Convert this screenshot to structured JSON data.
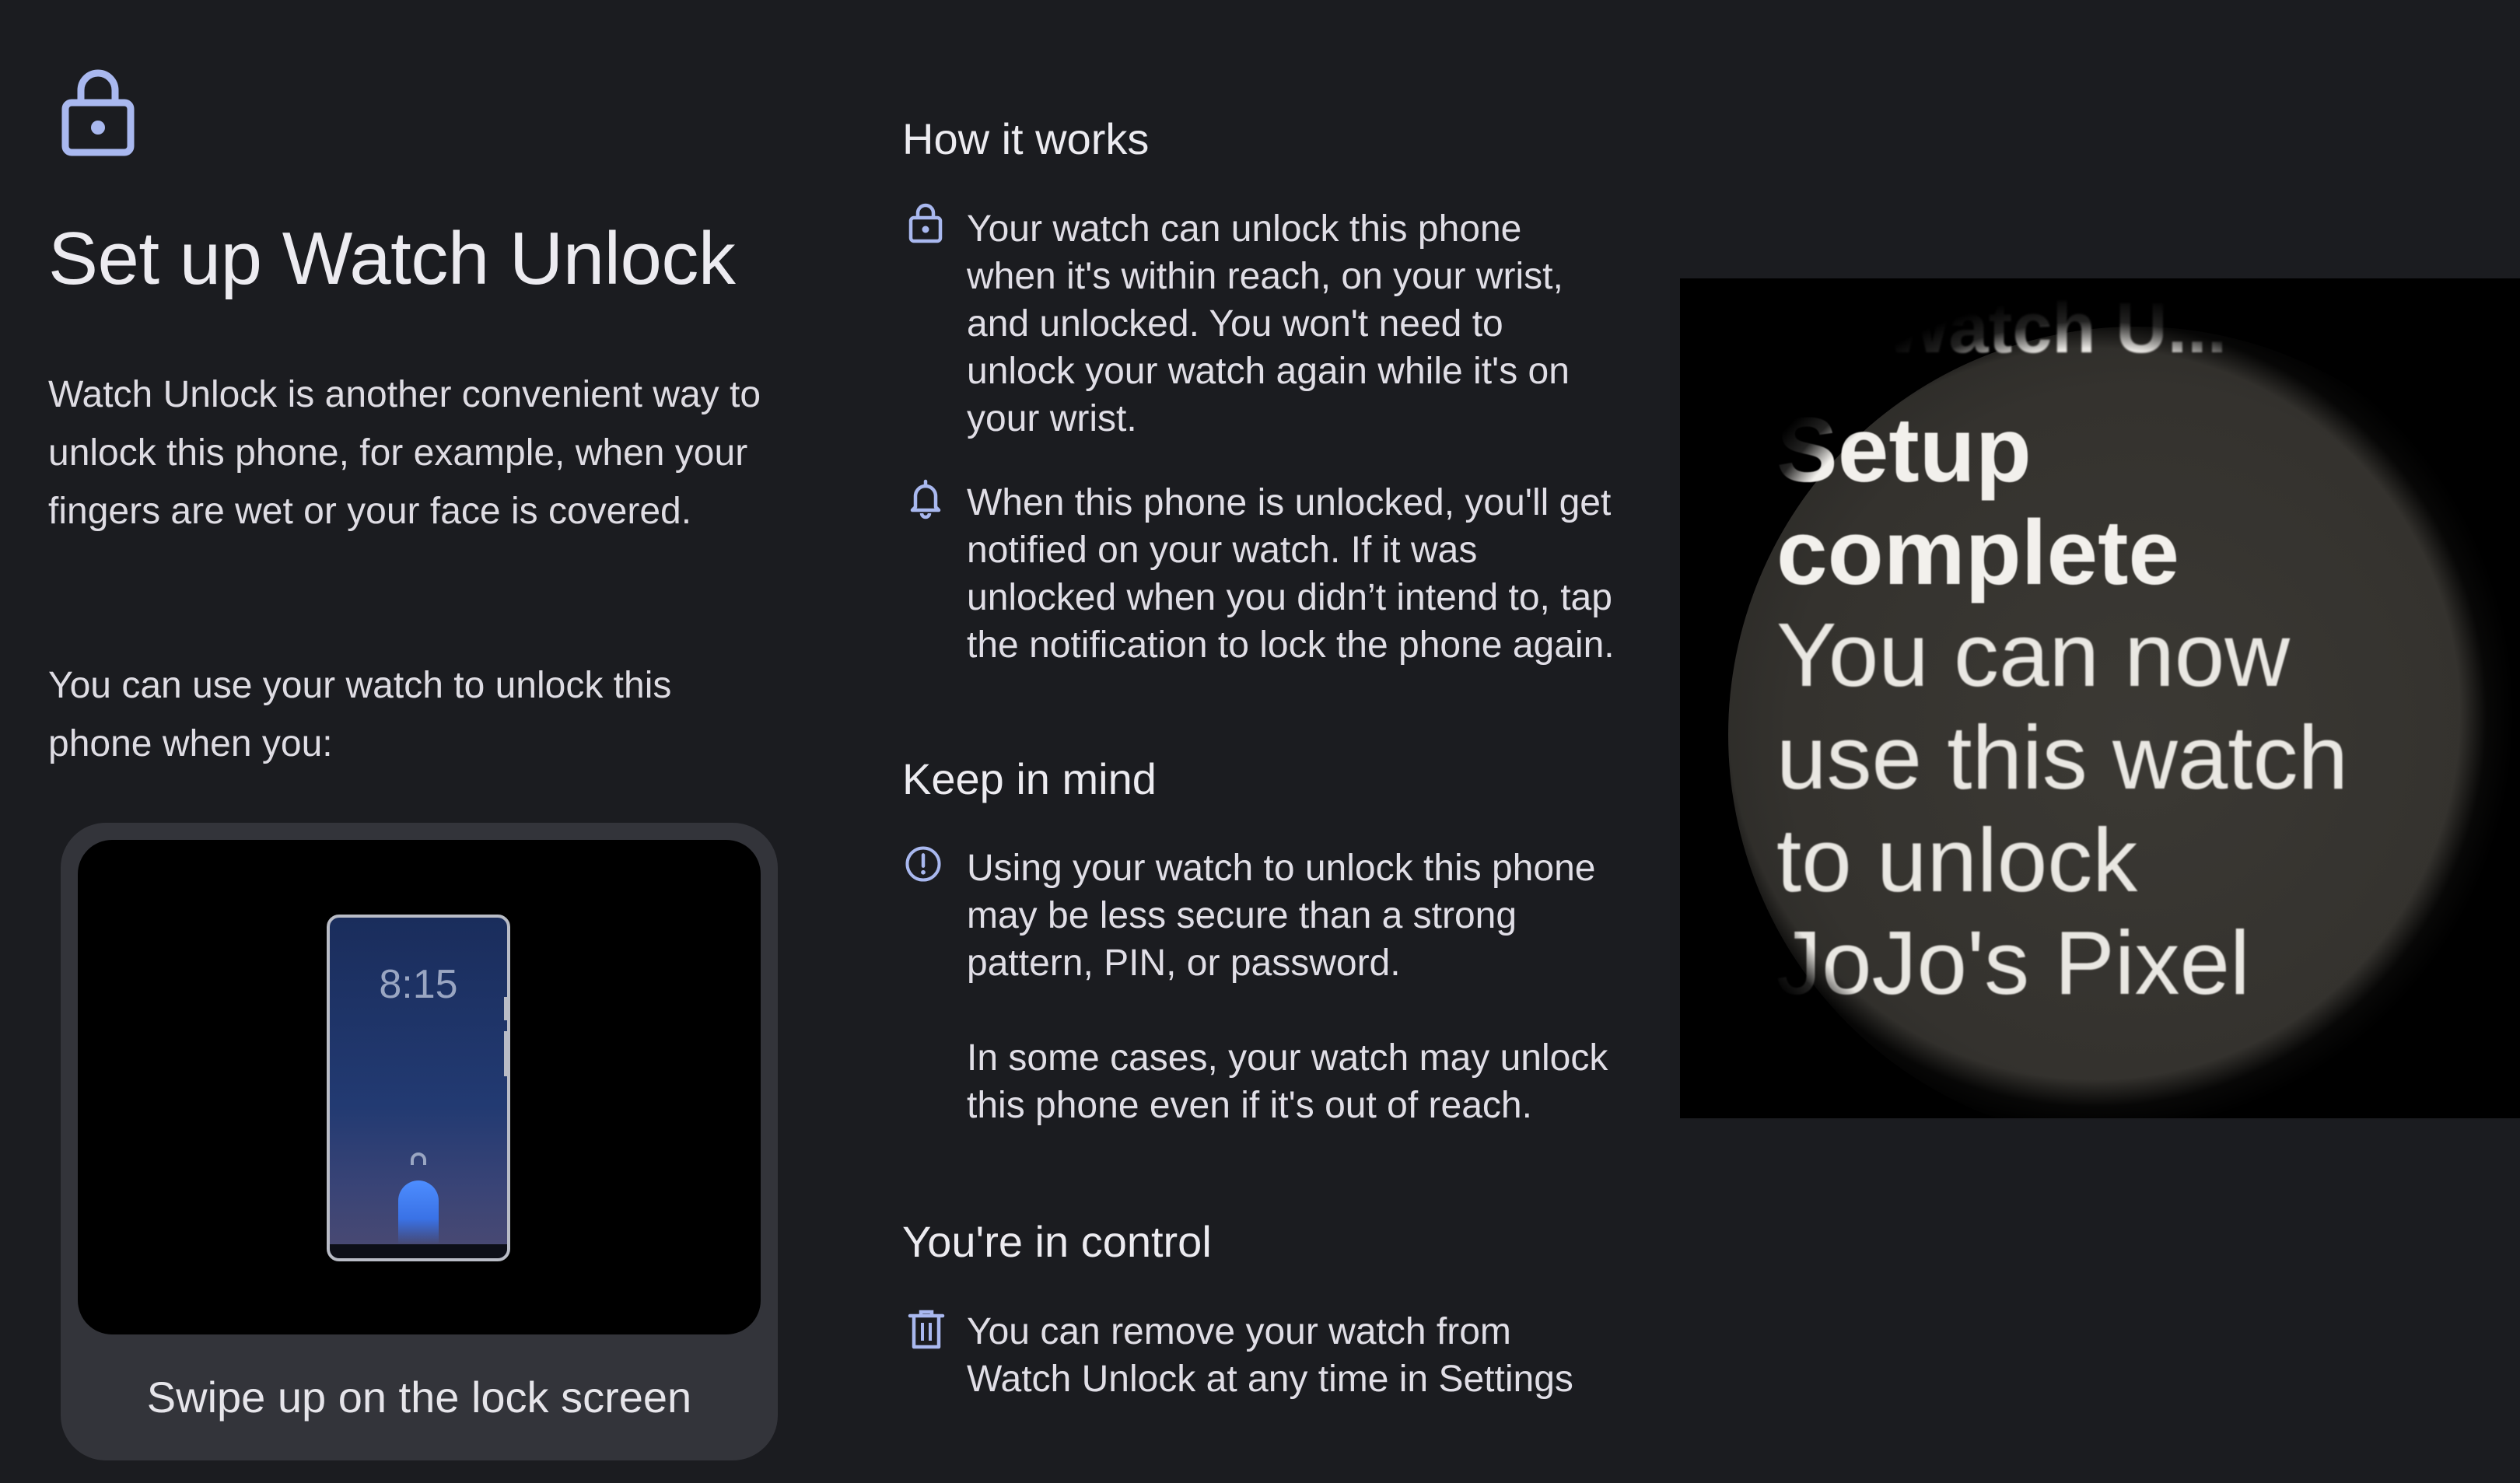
{
  "colors": {
    "background": "#1b1c20",
    "icon_accent": "#a9b8ef",
    "card_bg": "#33343a",
    "watch_bg": "#000000"
  },
  "hero_icon": "lock-icon",
  "page_title": "Set up Watch Unlock",
  "intro_text": "Watch Unlock is another convenient way to unlock this phone, for example, when your fingers are wet or your face is covered.",
  "intro_text_2": "You can use your watch to unlock this phone when you:",
  "illustration": {
    "phone_clock": "8:15",
    "caption": "Swipe up on the lock screen"
  },
  "how_it_works": {
    "heading": "How it works",
    "items": [
      {
        "icon": "lock-icon",
        "text": "Your watch can unlock this phone when it's within reach, on your wrist, and unlocked. You won't need to unlock your watch again while it's on your wrist."
      },
      {
        "icon": "bell-icon",
        "text": "When this phone is unlocked, you'll get notified on your watch. If it was unlocked when you didn’t intend to, tap the notification to lock the phone again."
      }
    ]
  },
  "keep_in_mind": {
    "heading": "Keep in mind",
    "items": [
      {
        "icon": "alert-icon",
        "text": "Using your watch to unlock this phone may be less secure than a strong pattern, PIN, or password."
      },
      {
        "icon": "",
        "text": "In some cases, your watch may unlock this phone even if it's out of reach."
      }
    ]
  },
  "in_control": {
    "heading": "You're in control",
    "items": [
      {
        "icon": "trash-icon",
        "text": "You can remove your watch from Watch Unlock at any time in Settings"
      }
    ]
  },
  "watch": {
    "header": "Watch U...",
    "title_line1": "Setup",
    "title_line2": "complete",
    "body_line1": "You can now",
    "body_line2": "use this watch",
    "body_line3": "to unlock",
    "body_line4": "JoJo's Pixel"
  }
}
